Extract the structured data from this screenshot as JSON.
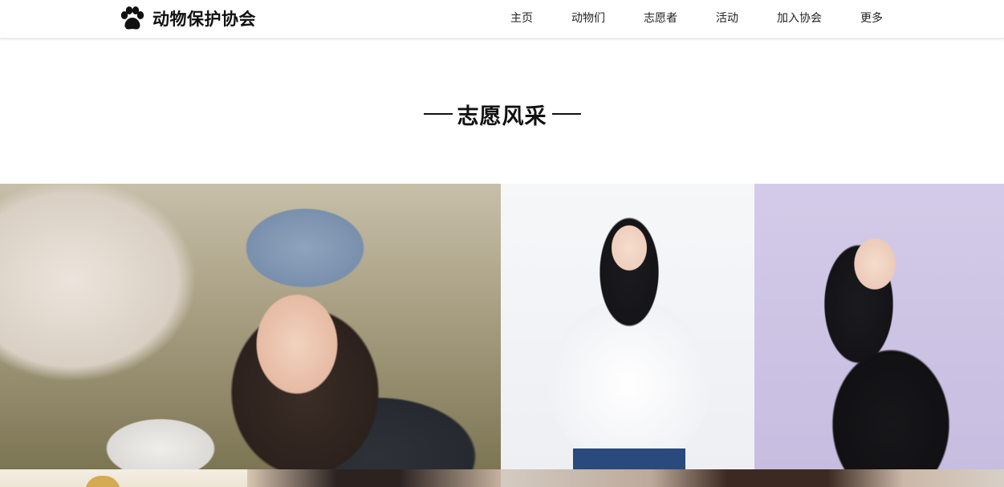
{
  "header": {
    "logo_icon": "paw-icon",
    "logo_text": "动物保护协会",
    "nav": [
      {
        "label": "主页"
      },
      {
        "label": "动物们"
      },
      {
        "label": "志愿者"
      },
      {
        "label": "活动"
      },
      {
        "label": "加入协会"
      },
      {
        "label": "更多"
      }
    ]
  },
  "section": {
    "title": "志愿风采"
  },
  "gallery": {
    "photos": [
      {
        "name": "volunteer-photo-beanie"
      },
      {
        "name": "volunteer-photo-white-blouse"
      },
      {
        "name": "volunteer-photo-lavender"
      },
      {
        "name": "volunteer-photo-row2-1"
      },
      {
        "name": "volunteer-photo-row2-2"
      },
      {
        "name": "volunteer-photo-row2-3"
      }
    ]
  },
  "colors": {
    "text": "#222222",
    "title": "#111111",
    "background": "#ffffff"
  }
}
